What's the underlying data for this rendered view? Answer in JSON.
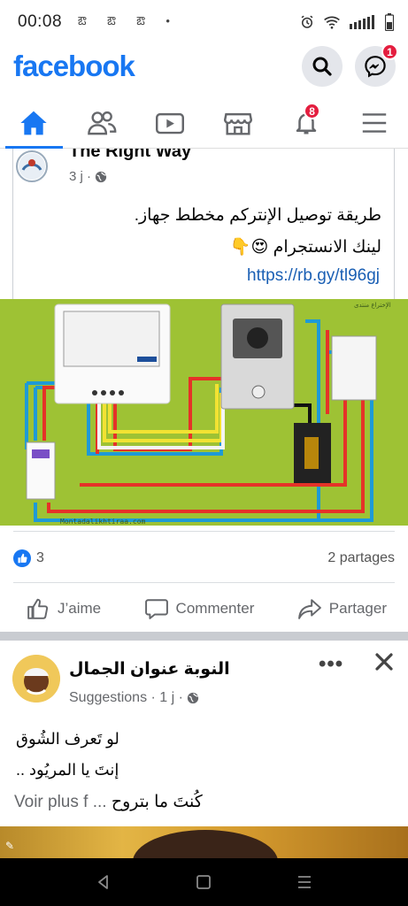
{
  "status_bar": {
    "time": "00:08",
    "notifications": "ఔ ఔ ఔ •"
  },
  "header": {
    "logo": "facebook",
    "messenger_badge": "1"
  },
  "tabs": {
    "items": [
      "home",
      "friends",
      "watch",
      "marketplace",
      "notifications",
      "menu"
    ],
    "notifications_badge": "8",
    "active": "home"
  },
  "post1": {
    "author": "The Right Way",
    "time": "3 j ·",
    "text_line1": "طريقة توصيل الإنتركم  مخطط جهاز.",
    "text_line2": "لينك الانستجرام 😍👇",
    "link": "https://rb.gy/tl96gj",
    "diagram": {
      "watermark": "Montadalikhtiraa.com",
      "corner_mark": "الإختراع منتدى"
    },
    "reactions_count": "3",
    "shares": "2 partages",
    "actions": {
      "like": "J’aime",
      "comment": "Commenter",
      "share": "Partager"
    }
  },
  "post2": {
    "author": "النوبة عنوان الجمال",
    "meta": "Suggestions · 1 j ·",
    "line1": "لو تَعرف الشُوق",
    "line2": "إنتَ يا المريُود ..",
    "line3": "كُنتَ ما بتروح",
    "voir_plus": "Voir plus",
    "voir_prefix": "f ...",
    "more": "•••"
  },
  "colors": {
    "brand": "#1877f2",
    "badge": "#e41e3f",
    "diagram_bg": "#9ec234"
  }
}
